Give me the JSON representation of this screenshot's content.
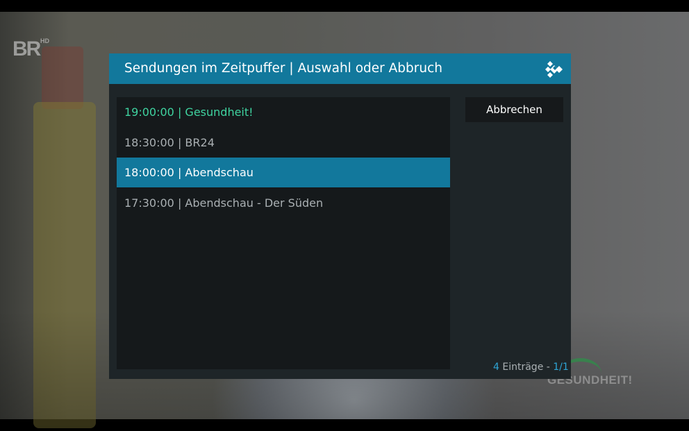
{
  "colors": {
    "header_bg": "#12789c",
    "dialog_bg": "#1e2528",
    "list_bg": "#15191b",
    "current_item": "#3fd3a0",
    "focused_item_bg": "#12789c",
    "count_accent": "#2ea5d6"
  },
  "background": {
    "channel_logo": "BR",
    "channel_logo_suffix": "HD",
    "show_logo": "GESUNDHEIT!"
  },
  "dialog": {
    "title": "Sendungen im Zeitpuffer | Auswahl oder Abbruch",
    "brand_icon": "kodi-icon",
    "items": [
      {
        "label": "19:00:00 | Gesundheit!",
        "state": "current"
      },
      {
        "label": "18:30:00 | BR24",
        "state": "normal"
      },
      {
        "label": "18:00:00 | Abendschau",
        "state": "focused"
      },
      {
        "label": "17:30:00 | Abendschau - Der Süden",
        "state": "normal"
      }
    ],
    "cancel_label": "Abbrechen",
    "footer": {
      "count": "4",
      "count_label": " Einträge - ",
      "page": "1/1"
    }
  }
}
